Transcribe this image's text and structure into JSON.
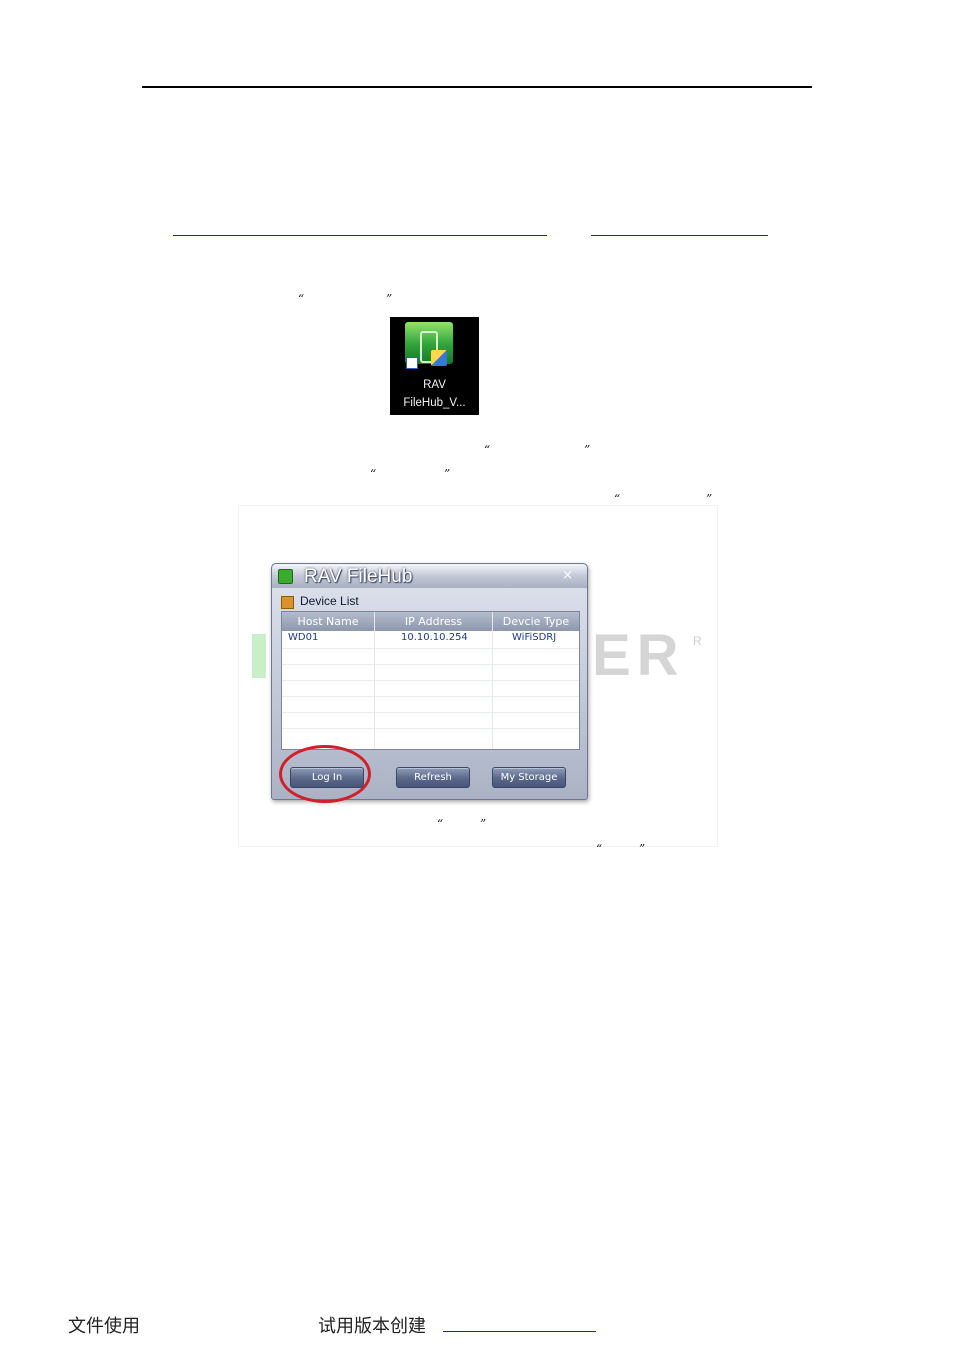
{
  "icon": {
    "label_line1": "RAV",
    "label_line2": "FileHub_V..."
  },
  "quotes": {
    "open": "“",
    "close": "”"
  },
  "watermark": {
    "fragment": "ER",
    "mark": "R"
  },
  "dialog": {
    "title": "RAV FileHub",
    "close_glyph": "×",
    "section_label": "Device List",
    "columns": [
      "Host Name",
      "IP Address",
      "Devcie Type"
    ],
    "rows": [
      {
        "host": "WD01",
        "ip": "10.10.10.254",
        "type": "WiFiSDRJ"
      }
    ],
    "buttons": {
      "login": "Log In",
      "refresh": "Refresh",
      "storage": "My Storage"
    }
  },
  "footer": {
    "left": "文件使用",
    "middle": "试用版本创建"
  },
  "colors": {
    "rule": "#000000",
    "link": "#1d1dc8",
    "highlight_ring": "#d0202a",
    "dialog_bg": "#aab2c4"
  }
}
